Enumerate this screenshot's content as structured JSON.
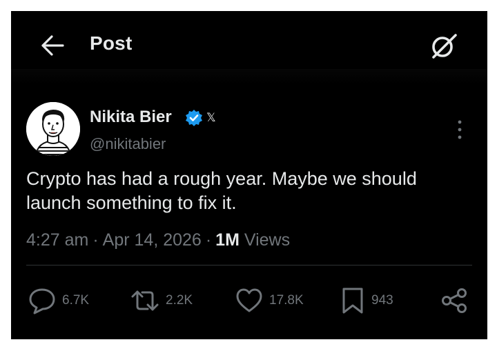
{
  "header": {
    "title": "Post",
    "back_icon": "arrow-left-icon",
    "grok_icon": "grok-icon"
  },
  "post": {
    "author": {
      "display_name": "Nikita Bier",
      "handle": "@nikitabier",
      "verified": true,
      "verified_color": "#1d9bf0",
      "affiliation_badge": "𝕏"
    },
    "text": "Crypto has had a rough year. Maybe we should launch something to fix it.",
    "time": "4:27 am",
    "date": "Apr 14, 2026",
    "views_count": "1M",
    "views_label": "Views"
  },
  "actions": {
    "replies": "6.7K",
    "reposts": "2.2K",
    "likes": "17.8K",
    "bookmarks": "943"
  },
  "colors": {
    "background": "#000000",
    "primary_text": "#e7e9ea",
    "secondary_text": "#71767b",
    "divider": "#2f3336",
    "accent": "#1d9bf0"
  }
}
